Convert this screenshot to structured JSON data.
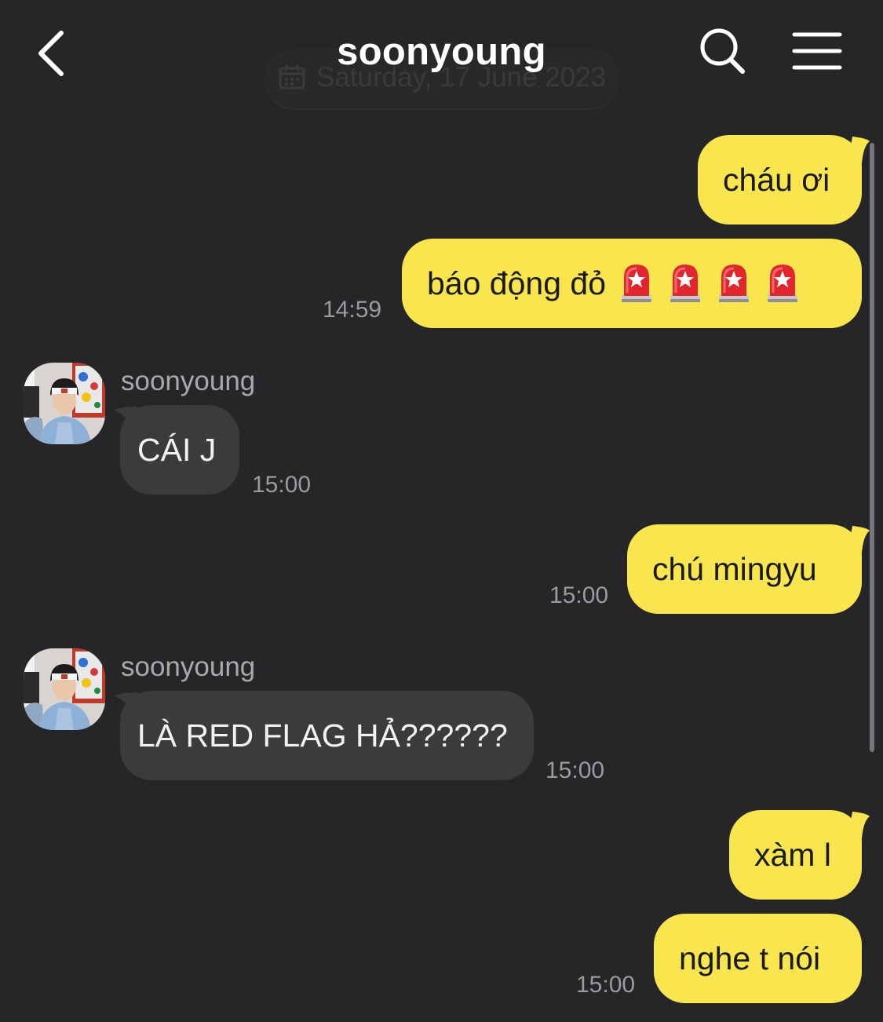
{
  "header": {
    "title": "soonyoung",
    "date_separator": "Saturday, 17 June 2023"
  },
  "messages": {
    "m1": {
      "text": "cháu ơi"
    },
    "m2": {
      "text": "báo động đỏ",
      "time": "14:59",
      "emoji": "police-car-light"
    },
    "m3": {
      "sender": "soonyoung",
      "text": "CÁI J",
      "time": "15:00"
    },
    "m4": {
      "text": "chú mingyu",
      "time": "15:00"
    },
    "m5": {
      "sender": "soonyoung",
      "text": "LÀ RED FLAG HẢ??????",
      "time": "15:00"
    },
    "m6": {
      "text": "xàm l"
    },
    "m7": {
      "text": "nghe t nói",
      "time": "15:00"
    }
  },
  "colors": {
    "background": "#262628",
    "outgoing_bubble": "#f9e54e",
    "incoming_bubble": "#3b3b3e"
  }
}
